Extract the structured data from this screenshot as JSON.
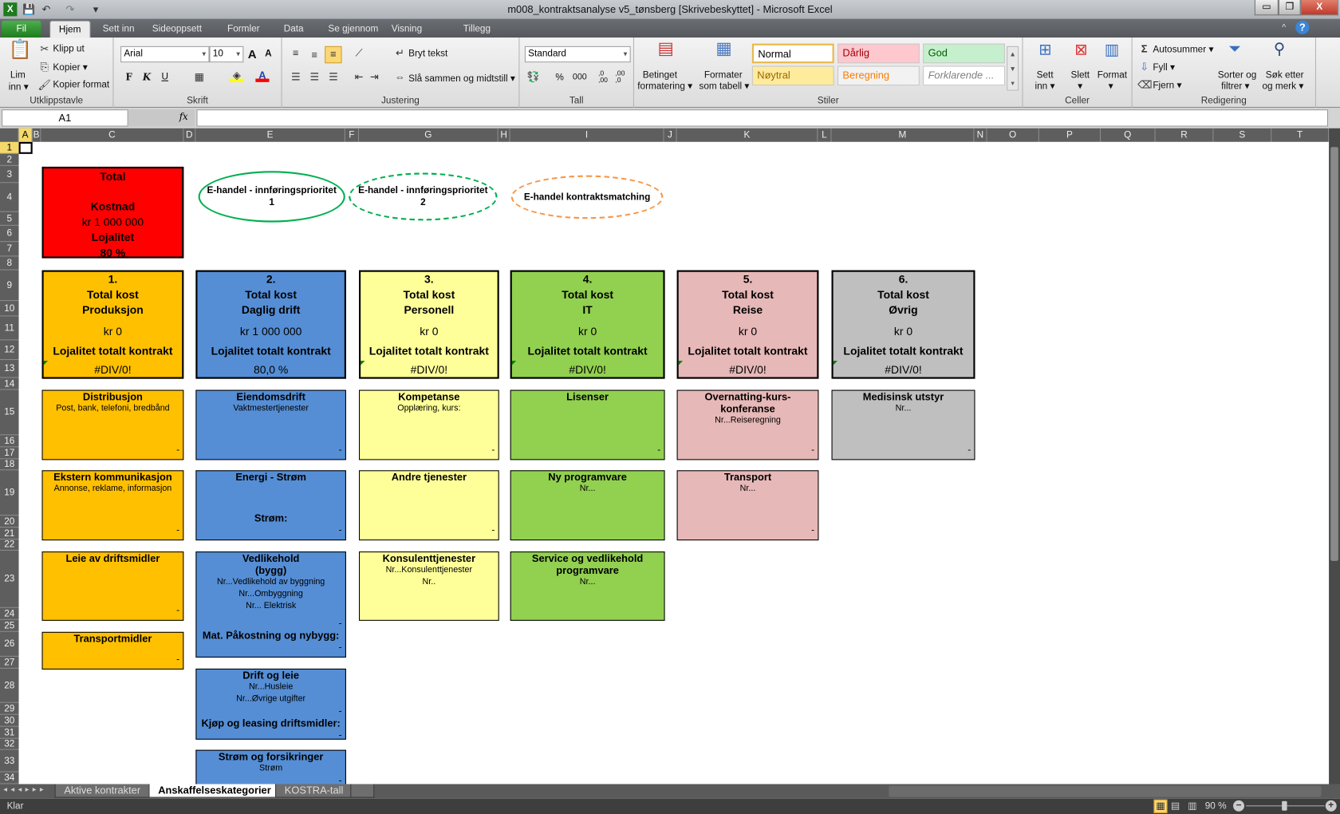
{
  "window": {
    "title": "m008_kontraktsanalyse v5_tønsberg  [Skrivebeskyttet]  -  Microsoft Excel",
    "minimize": "▭",
    "restore": "❐",
    "close": "X"
  },
  "ribbon_tabs": [
    "Fil",
    "Hjem",
    "Sett inn",
    "Sideoppsett",
    "Formler",
    "Data",
    "Se gjennom",
    "Visning",
    "Tillegg"
  ],
  "active_tab": "Hjem",
  "ribbon": {
    "clipboard": {
      "label": "Utklippstavle",
      "paste": "Lim",
      "paste2": "inn ▾",
      "cut": "Klipp ut",
      "copy": "Kopier ▾",
      "format_painter": "Kopier format"
    },
    "font": {
      "label": "Skrift",
      "font_name": "Arial",
      "font_size": "10",
      "bold": "F",
      "italic": "K",
      "underline": "U",
      "grow": "A",
      "shrink": "A"
    },
    "alignment": {
      "label": "Justering",
      "wrap": "Bryt tekst",
      "merge": "Slå sammen og midtstill ▾"
    },
    "number": {
      "label": "Tall",
      "format": "Standard",
      "percent": "%",
      "thousands": "000",
      "inc_dec": ",0 ,00",
      "dec_dec": ",00 ,0"
    },
    "styles": {
      "label": "Stiler",
      "cond_format": "Betinget",
      "cond_format2": "formatering ▾",
      "table_format": "Formater",
      "table_format2": "som tabell ▾",
      "items": [
        {
          "name": "Normal",
          "bg": "#ffffff",
          "fg": "#000000"
        },
        {
          "name": "Dårlig",
          "bg": "#ffc7ce",
          "fg": "#9c0006"
        },
        {
          "name": "God",
          "bg": "#c6efce",
          "fg": "#006100"
        },
        {
          "name": "Nøytral",
          "bg": "#ffeb9c",
          "fg": "#9c6500"
        },
        {
          "name": "Beregning",
          "bg": "#f2f2f2",
          "fg": "#fa7d00"
        },
        {
          "name": "Forklarende ...",
          "bg": "#ffffff",
          "fg": "#7f7f7f"
        }
      ]
    },
    "cells": {
      "label": "Celler",
      "insert": "Sett",
      "insert2": "inn ▾",
      "delete": "Slett",
      "delete2": "▾",
      "format": "Format",
      "format2": "▾"
    },
    "editing": {
      "label": "Redigering",
      "autosum": "Autosummer ▾",
      "fill": "Fyll ▾",
      "clear": "Fjern ▾",
      "sort": "Sorter og",
      "sort2": "filtrer ▾",
      "find": "Søk etter",
      "find2": "og merk ▾"
    }
  },
  "formula_bar": {
    "name_box": "A1",
    "fx": "fx",
    "value": ""
  },
  "columns": [
    "A",
    "B",
    "C",
    "D",
    "E",
    "F",
    "G",
    "H",
    "I",
    "J",
    "K",
    "L",
    "M",
    "N",
    "O",
    "P",
    "Q",
    "R",
    "S",
    "T"
  ],
  "rows": [
    "1",
    "2",
    "3",
    "4",
    "5",
    "6",
    "7",
    "8",
    "9",
    "10",
    "11",
    "12",
    "13",
    "14",
    "15",
    "16",
    "17",
    "18",
    "19",
    "20",
    "21",
    "22",
    "23",
    "24",
    "25",
    "26",
    "27",
    "28",
    "29",
    "30",
    "31",
    "32",
    "33",
    "34"
  ],
  "selected_cell": "A1",
  "total_box": {
    "title": "Total",
    "cost_label": "Kostnad",
    "cost": "kr 1 000 000",
    "loyalty_label": "Lojalitet",
    "loyalty": "80 %",
    "color": "#ff0000"
  },
  "ovals": [
    {
      "text": "E-handel - innføringsprioritet 1",
      "color": "#00b050",
      "style": "solid"
    },
    {
      "text": "E-handel - innføringsprioritet 2",
      "color": "#00b050",
      "style": "dashed"
    },
    {
      "text": "E-handel kontraktsmatching",
      "color": "#f79646",
      "style": "dashed"
    }
  ],
  "categories": [
    {
      "num": "1.",
      "label": "Total kost",
      "name": "Produksjon",
      "cost": "kr 0",
      "loyalty_label": "Lojalitet totalt kontrakt",
      "loyalty": "#DIV/0!",
      "color": "#ffc000",
      "items": [
        {
          "title": [
            "Distribusjon"
          ],
          "lines": [
            "Post, bank, telefoni, bredbånd"
          ],
          "foot": [
            {
              "text": "-",
              "k": "d"
            }
          ]
        },
        {
          "title": [
            "Ekstern kommunikasjon"
          ],
          "lines": [
            "Annonse, reklame, informasjon"
          ],
          "foot": [
            {
              "text": "-",
              "k": "d"
            }
          ]
        },
        {
          "title": [
            "Leie av driftsmidler"
          ],
          "lines": [],
          "foot": [
            {
              "text": "-",
              "k": "d"
            }
          ]
        },
        {
          "title": [
            "Transportmidler"
          ],
          "lines": [],
          "foot": [
            {
              "text": "-",
              "k": "d"
            }
          ]
        }
      ]
    },
    {
      "num": "2.",
      "label": "Total kost",
      "name": "Daglig drift",
      "cost": "kr 1 000 000",
      "loyalty_label": "Lojalitet totalt kontrakt",
      "loyalty": "80,0 %",
      "color": "#558ed5",
      "items": [
        {
          "title": [
            "Eiendomsdrift"
          ],
          "lines": [
            "Vaktmestertjenester"
          ],
          "foot": [
            {
              "text": "-",
              "k": "d"
            }
          ]
        },
        {
          "title": [
            "Energi - Strøm"
          ],
          "lines": [],
          "foot": [
            {
              "text": "Strøm:",
              "k": "b"
            },
            {
              "text": "-",
              "k": "d"
            }
          ]
        },
        {
          "title": [
            "Vedlikehold",
            "(bygg)"
          ],
          "lines": [
            "Nr...Vedlikehold av byggning",
            "Nr...Ombyggning",
            "Nr... Elektrisk"
          ],
          "foot": [
            {
              "text": "-",
              "k": "d"
            },
            {
              "text": "Mat. Påkostning og nybygg:",
              "k": "b"
            },
            {
              "text": "-",
              "k": "d"
            }
          ]
        },
        {
          "title": [
            "Drift og leie"
          ],
          "lines": [
            "Nr...Husleie",
            "Nr...Øvrige utgifter"
          ],
          "foot": [
            {
              "text": "-",
              "k": "d"
            },
            {
              "text": "Kjøp og leasing driftsmidler:",
              "k": "b"
            },
            {
              "text": "-",
              "k": "d"
            }
          ]
        },
        {
          "title": [
            "Strøm og forsikringer"
          ],
          "lines": [
            "Strøm"
          ],
          "foot": [
            {
              "text": "-",
              "k": "d"
            }
          ]
        }
      ]
    },
    {
      "num": "3.",
      "label": "Total kost",
      "name": "Personell",
      "cost": "kr 0",
      "loyalty_label": "Lojalitet totalt kontrakt",
      "loyalty": "#DIV/0!",
      "color": "#ffff99",
      "items": [
        {
          "title": [
            "Kompetanse"
          ],
          "lines": [
            "Opplæring, kurs:"
          ],
          "foot": [
            {
              "text": "-",
              "k": "d"
            }
          ]
        },
        {
          "title": [
            "Andre tjenester"
          ],
          "lines": [],
          "foot": [
            {
              "text": "-",
              "k": "d"
            }
          ]
        },
        {
          "title": [
            "Konsulenttjenester"
          ],
          "lines": [
            "Nr...Konsulenttjenester",
            "Nr.."
          ],
          "foot": []
        }
      ]
    },
    {
      "num": "4.",
      "label": "Total kost",
      "name": "IT",
      "cost": "kr 0",
      "loyalty_label": "Lojalitet totalt kontrakt",
      "loyalty": "#DIV/0!",
      "color": "#92d050",
      "items": [
        {
          "title": [
            "Lisenser"
          ],
          "lines": [],
          "foot": [
            {
              "text": "-",
              "k": "d"
            }
          ]
        },
        {
          "title": [
            "Ny programvare"
          ],
          "lines": [
            "Nr..."
          ],
          "foot": []
        },
        {
          "title": [
            "Service og vedlikehold",
            "programvare"
          ],
          "lines": [
            "Nr..."
          ],
          "foot": []
        }
      ]
    },
    {
      "num": "5.",
      "label": "Total kost",
      "name": "Reise",
      "cost": "kr 0",
      "loyalty_label": "Lojalitet totalt kontrakt",
      "loyalty": "#DIV/0!",
      "color": "#e6b8b7",
      "items": [
        {
          "title": [
            "Overnatting-kurs-konferanse"
          ],
          "lines": [
            "Nr...Reiseregning"
          ],
          "foot": [
            {
              "text": "-",
              "k": "d"
            }
          ]
        },
        {
          "title": [
            "Transport"
          ],
          "lines": [
            "Nr..."
          ],
          "foot": [
            {
              "text": "-",
              "k": "d"
            }
          ]
        }
      ]
    },
    {
      "num": "6.",
      "label": "Total kost",
      "name": "Øvrig",
      "cost": "kr 0",
      "loyalty_label": "Lojalitet totalt kontrakt",
      "loyalty": "#DIV/0!",
      "color": "#bfbfbf",
      "items": [
        {
          "title": [
            "Medisinsk utstyr"
          ],
          "lines": [
            "Nr..."
          ],
          "foot": [
            {
              "text": "-",
              "k": "d"
            }
          ]
        }
      ]
    }
  ],
  "sheet_tabs": [
    "Aktive kontrakter",
    "Anskaffelseskategorier",
    "KOSTRA-tall"
  ],
  "active_sheet": "Anskaffelseskategorier",
  "status": {
    "text": "Klar",
    "zoom": "90 %",
    "zoom_percent": 90
  }
}
